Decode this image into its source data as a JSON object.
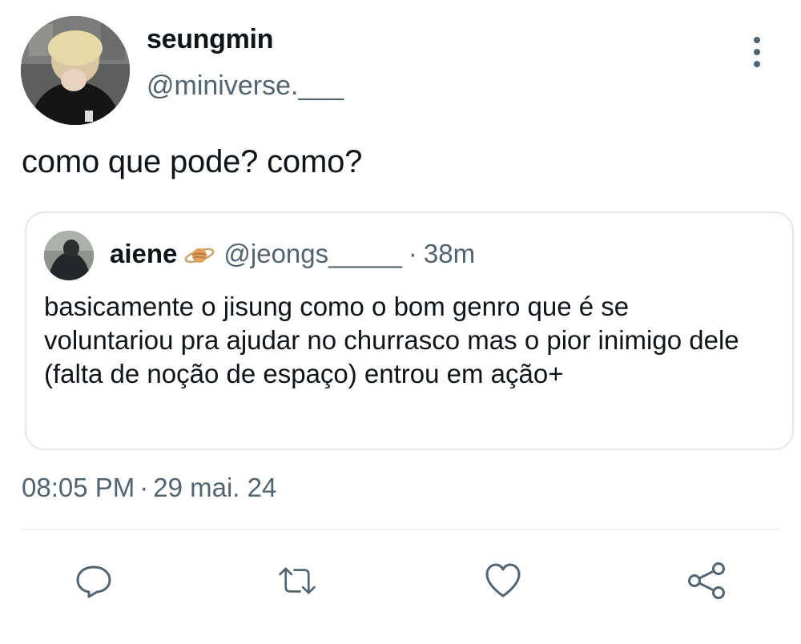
{
  "author": {
    "display_name": "seungmin",
    "handle": "@miniverse.___"
  },
  "tweet": {
    "text": "como que pode? como?",
    "time": "08:05 PM",
    "separator": "·",
    "date": "29 mai. 24"
  },
  "quoted": {
    "display_name": "aiene",
    "emoji_icon": "ringed-planet-icon",
    "handle": "@jeongs_____",
    "separator": "·",
    "time": "38m",
    "text": "basicamente o jisung como o bom genro que é se voluntariou pra ajudar no churrasco mas o pior inimigo dele (falta de noção de espaço) entrou em ação+"
  },
  "actions": [
    {
      "icon": "reply-icon"
    },
    {
      "icon": "retweet-icon"
    },
    {
      "icon": "like-icon"
    },
    {
      "icon": "share-icon"
    }
  ],
  "colors": {
    "primary_text": "#0f1419",
    "secondary_text": "#536471",
    "border": "#e3e8ec"
  }
}
